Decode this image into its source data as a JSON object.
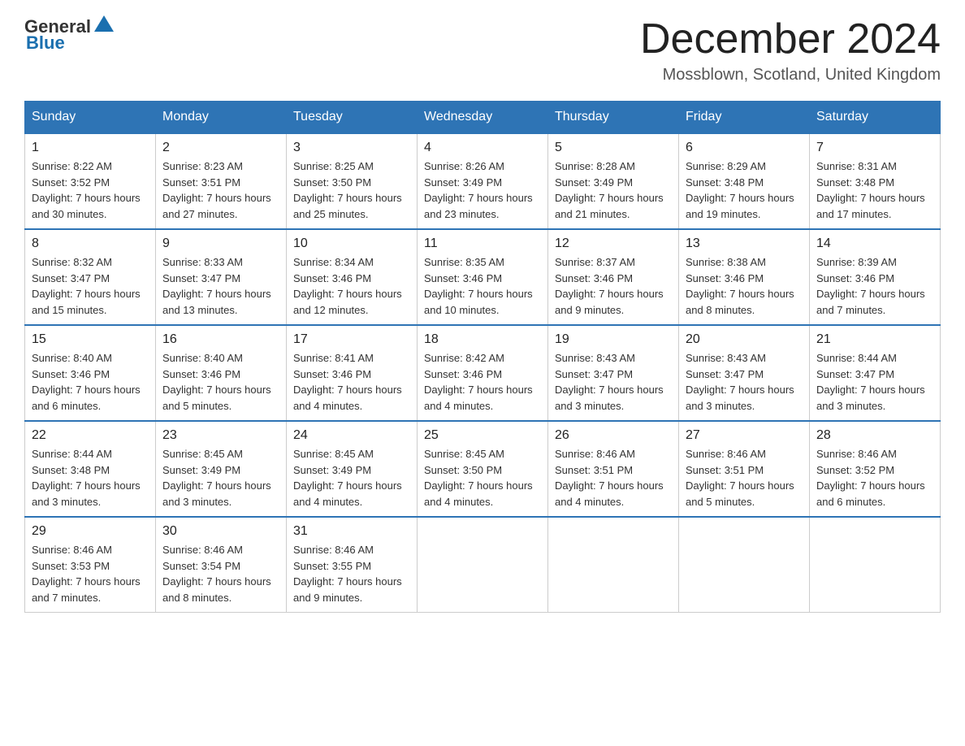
{
  "header": {
    "logo_general": "General",
    "logo_blue": "Blue",
    "month_title": "December 2024",
    "location": "Mossblown, Scotland, United Kingdom"
  },
  "days_of_week": [
    "Sunday",
    "Monday",
    "Tuesday",
    "Wednesday",
    "Thursday",
    "Friday",
    "Saturday"
  ],
  "weeks": [
    [
      {
        "day": "1",
        "sunrise": "8:22 AM",
        "sunset": "3:52 PM",
        "daylight": "7 hours and 30 minutes."
      },
      {
        "day": "2",
        "sunrise": "8:23 AM",
        "sunset": "3:51 PM",
        "daylight": "7 hours and 27 minutes."
      },
      {
        "day": "3",
        "sunrise": "8:25 AM",
        "sunset": "3:50 PM",
        "daylight": "7 hours and 25 minutes."
      },
      {
        "day": "4",
        "sunrise": "8:26 AM",
        "sunset": "3:49 PM",
        "daylight": "7 hours and 23 minutes."
      },
      {
        "day": "5",
        "sunrise": "8:28 AM",
        "sunset": "3:49 PM",
        "daylight": "7 hours and 21 minutes."
      },
      {
        "day": "6",
        "sunrise": "8:29 AM",
        "sunset": "3:48 PM",
        "daylight": "7 hours and 19 minutes."
      },
      {
        "day": "7",
        "sunrise": "8:31 AM",
        "sunset": "3:48 PM",
        "daylight": "7 hours and 17 minutes."
      }
    ],
    [
      {
        "day": "8",
        "sunrise": "8:32 AM",
        "sunset": "3:47 PM",
        "daylight": "7 hours and 15 minutes."
      },
      {
        "day": "9",
        "sunrise": "8:33 AM",
        "sunset": "3:47 PM",
        "daylight": "7 hours and 13 minutes."
      },
      {
        "day": "10",
        "sunrise": "8:34 AM",
        "sunset": "3:46 PM",
        "daylight": "7 hours and 12 minutes."
      },
      {
        "day": "11",
        "sunrise": "8:35 AM",
        "sunset": "3:46 PM",
        "daylight": "7 hours and 10 minutes."
      },
      {
        "day": "12",
        "sunrise": "8:37 AM",
        "sunset": "3:46 PM",
        "daylight": "7 hours and 9 minutes."
      },
      {
        "day": "13",
        "sunrise": "8:38 AM",
        "sunset": "3:46 PM",
        "daylight": "7 hours and 8 minutes."
      },
      {
        "day": "14",
        "sunrise": "8:39 AM",
        "sunset": "3:46 PM",
        "daylight": "7 hours and 7 minutes."
      }
    ],
    [
      {
        "day": "15",
        "sunrise": "8:40 AM",
        "sunset": "3:46 PM",
        "daylight": "7 hours and 6 minutes."
      },
      {
        "day": "16",
        "sunrise": "8:40 AM",
        "sunset": "3:46 PM",
        "daylight": "7 hours and 5 minutes."
      },
      {
        "day": "17",
        "sunrise": "8:41 AM",
        "sunset": "3:46 PM",
        "daylight": "7 hours and 4 minutes."
      },
      {
        "day": "18",
        "sunrise": "8:42 AM",
        "sunset": "3:46 PM",
        "daylight": "7 hours and 4 minutes."
      },
      {
        "day": "19",
        "sunrise": "8:43 AM",
        "sunset": "3:47 PM",
        "daylight": "7 hours and 3 minutes."
      },
      {
        "day": "20",
        "sunrise": "8:43 AM",
        "sunset": "3:47 PM",
        "daylight": "7 hours and 3 minutes."
      },
      {
        "day": "21",
        "sunrise": "8:44 AM",
        "sunset": "3:47 PM",
        "daylight": "7 hours and 3 minutes."
      }
    ],
    [
      {
        "day": "22",
        "sunrise": "8:44 AM",
        "sunset": "3:48 PM",
        "daylight": "7 hours and 3 minutes."
      },
      {
        "day": "23",
        "sunrise": "8:45 AM",
        "sunset": "3:49 PM",
        "daylight": "7 hours and 3 minutes."
      },
      {
        "day": "24",
        "sunrise": "8:45 AM",
        "sunset": "3:49 PM",
        "daylight": "7 hours and 4 minutes."
      },
      {
        "day": "25",
        "sunrise": "8:45 AM",
        "sunset": "3:50 PM",
        "daylight": "7 hours and 4 minutes."
      },
      {
        "day": "26",
        "sunrise": "8:46 AM",
        "sunset": "3:51 PM",
        "daylight": "7 hours and 4 minutes."
      },
      {
        "day": "27",
        "sunrise": "8:46 AM",
        "sunset": "3:51 PM",
        "daylight": "7 hours and 5 minutes."
      },
      {
        "day": "28",
        "sunrise": "8:46 AM",
        "sunset": "3:52 PM",
        "daylight": "7 hours and 6 minutes."
      }
    ],
    [
      {
        "day": "29",
        "sunrise": "8:46 AM",
        "sunset": "3:53 PM",
        "daylight": "7 hours and 7 minutes."
      },
      {
        "day": "30",
        "sunrise": "8:46 AM",
        "sunset": "3:54 PM",
        "daylight": "7 hours and 8 minutes."
      },
      {
        "day": "31",
        "sunrise": "8:46 AM",
        "sunset": "3:55 PM",
        "daylight": "7 hours and 9 minutes."
      },
      null,
      null,
      null,
      null
    ]
  ]
}
